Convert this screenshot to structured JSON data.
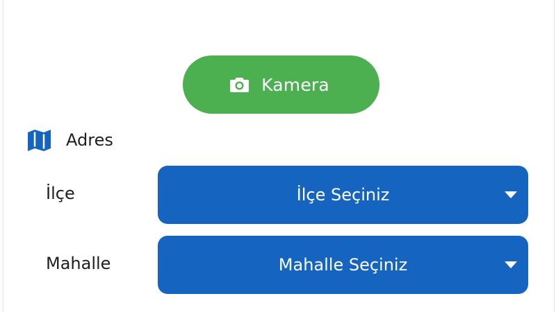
{
  "camera_button": {
    "label": "Kamera",
    "icon": "camera-icon",
    "color": "#4caf50"
  },
  "address_section": {
    "title": "Adres",
    "icon": "map-icon",
    "icon_color": "#1565c0"
  },
  "fields": {
    "ilce": {
      "label": "İlçe",
      "dropdown_text": "İlçe Seçiniz",
      "icon": "caret-down-icon"
    },
    "mahalle": {
      "label": "Mahalle",
      "dropdown_text": "Mahalle Seçiniz",
      "icon": "caret-down-icon"
    }
  },
  "colors": {
    "dropdown_bg": "#1565c0",
    "text_dark": "#1e1e1e",
    "text_light": "#ffffff"
  }
}
